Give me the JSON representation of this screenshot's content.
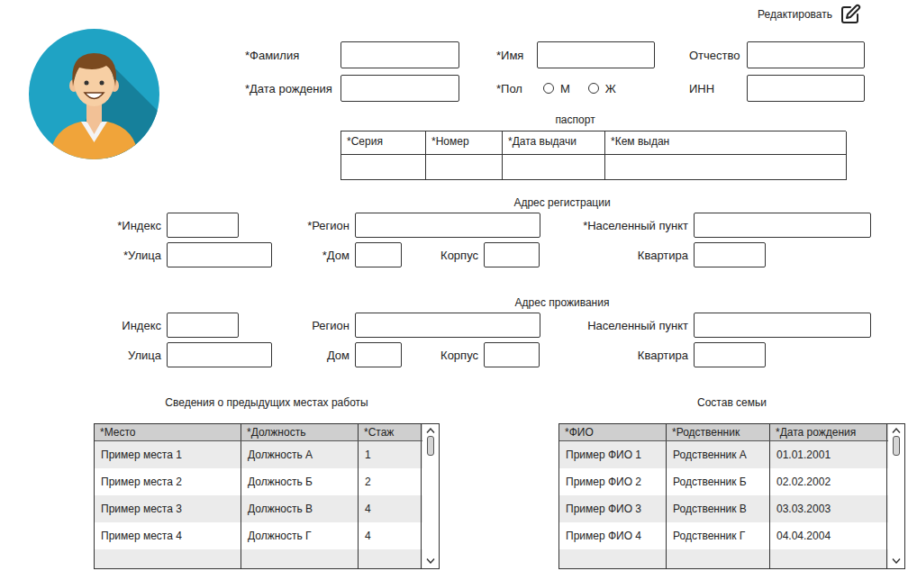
{
  "header": {
    "edit_button": "Редактировать"
  },
  "personal": {
    "rows": [
      {
        "fields": [
          {
            "kind": "input",
            "label": "*Фамилия"
          },
          {
            "kind": "input",
            "label": "*Имя"
          },
          {
            "kind": "input",
            "label": "Отчество"
          }
        ]
      },
      {
        "fields": [
          {
            "kind": "input",
            "label": "*Дата рождения"
          },
          {
            "kind": "radio",
            "label": "*Пол",
            "options": [
              {
                "label": "М",
                "selected": false
              },
              {
                "label": "Ж",
                "selected": false
              }
            ]
          },
          {
            "kind": "input",
            "label": "ИНН"
          }
        ]
      }
    ]
  },
  "passport": {
    "title": "паспорт",
    "columns": [
      "*Серия",
      "*Номер",
      "*Дата выдачи",
      "*Кем выдан"
    ]
  },
  "addresses": [
    {
      "title": "Адрес регистрации",
      "rows": [
        {
          "fields": [
            {
              "label": "*Индекс"
            },
            {
              "label": "*Регион"
            },
            {
              "label": "*Населенный пункт"
            }
          ]
        },
        {
          "fields": [
            {
              "label": "*Улица"
            },
            {
              "label": "*Дом"
            },
            {
              "label": "Корпус"
            },
            {
              "label": "Квартира"
            }
          ]
        }
      ]
    },
    {
      "title": "Адрес проживания",
      "rows": [
        {
          "fields": [
            {
              "label": "Индекс"
            },
            {
              "label": "Регион"
            },
            {
              "label": "Населенный пункт"
            }
          ]
        },
        {
          "fields": [
            {
              "label": "Улица"
            },
            {
              "label": "Дом"
            },
            {
              "label": "Корпус"
            },
            {
              "label": "Квартира"
            }
          ]
        }
      ]
    }
  ],
  "tables": [
    {
      "title": "Сведения о предыдущих местах работы",
      "columns": [
        "*Место",
        "*Должность",
        "*Стаж"
      ],
      "rows": [
        [
          "Пример места 1",
          "Должность А",
          "1"
        ],
        [
          "Пример места 2",
          "Должность Б",
          "2"
        ],
        [
          "Пример места 3",
          "Должность В",
          "4"
        ],
        [
          "Пример места 4",
          "Должность Г",
          "4"
        ]
      ]
    },
    {
      "title": "Состав семьи",
      "columns": [
        "*ФИО",
        "*Родственник",
        "*Дата рождения"
      ],
      "rows": [
        [
          "Пример ФИО 1",
          "Родственник А",
          "01.01.2001"
        ],
        [
          "Пример ФИО 2",
          "Родственник Б",
          "02.02.2002"
        ],
        [
          "Пример ФИО 3",
          "Родственник В",
          "03.03.2003"
        ],
        [
          "Пример ФИО 4",
          "Родственник Г",
          "04.04.2004"
        ]
      ]
    }
  ]
}
